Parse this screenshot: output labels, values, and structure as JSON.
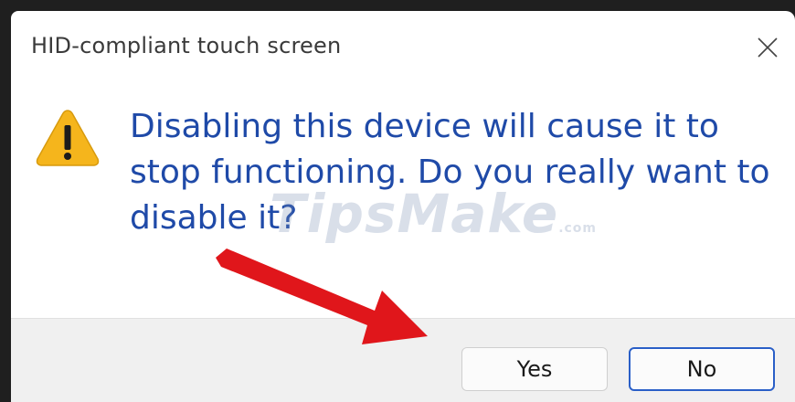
{
  "dialog": {
    "title": "HID-compliant touch screen",
    "close_icon": "close-icon",
    "warning_icon": "warning-icon",
    "message": "Disabling this device will cause it to stop functioning. Do you really want to disable it?",
    "buttons": {
      "yes_label": "Yes",
      "no_label": "No"
    }
  },
  "watermark": {
    "brand": "TipsMake",
    "suffix": ".com"
  },
  "colors": {
    "message_text": "#1f4aa8",
    "default_button_border": "#2a5fc7",
    "arrow": "#e0161b",
    "warning_fill": "#f5b51c"
  }
}
